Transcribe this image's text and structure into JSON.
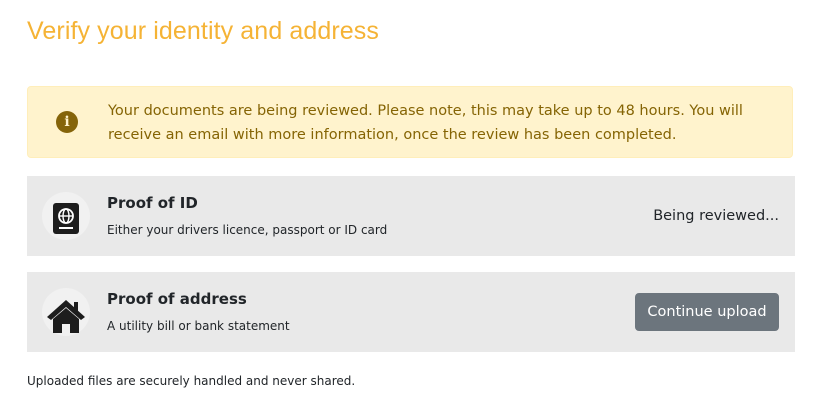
{
  "page": {
    "title": "Verify your identity and address",
    "title_color": "#f5b335"
  },
  "alert": {
    "icon": "info-circle-icon",
    "message": "Your documents are being reviewed. Please note, this may take up to 48 hours. You will receive an email with more information, once the review has been completed.",
    "background": "#fff3cd",
    "text_color": "#856404"
  },
  "documents": {
    "id": {
      "icon": "passport-icon",
      "title": "Proof of ID",
      "subtitle": "Either your drivers licence, passport or ID card",
      "status": "Being reviewed..."
    },
    "address": {
      "icon": "house-icon",
      "title": "Proof of address",
      "subtitle": "A utility bill or bank statement",
      "button_label": "Continue upload",
      "button_color": "#6c757d"
    },
    "card_background": "#e9e9e9"
  },
  "footer": {
    "note": "Uploaded files are securely handled and never shared."
  }
}
